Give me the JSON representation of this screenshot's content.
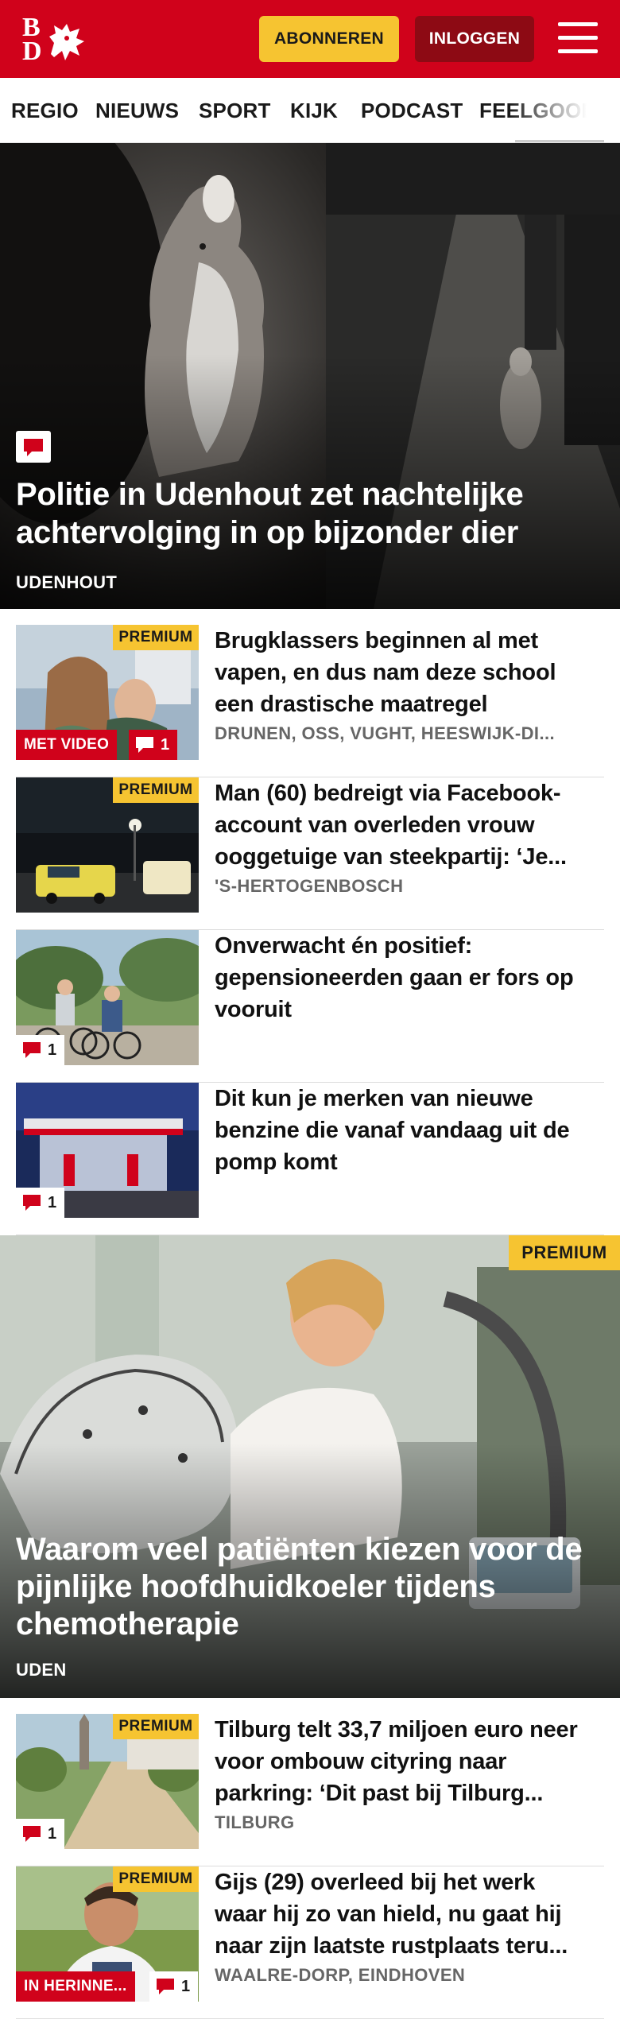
{
  "header": {
    "logo_alt": "BD",
    "logo_letters": {
      "top": "B",
      "bottom": "D"
    },
    "subscribe_label": "ABONNEREN",
    "login_label": "INLOGGEN",
    "colors": {
      "brand_red": "#d0021b",
      "subscribe_yellow": "#f6c431",
      "login_dark_red": "#8d0a14"
    }
  },
  "nav": {
    "items": [
      "REGIO",
      "NIEUWS",
      "SPORT",
      "KIJK",
      "PODCAST",
      "FEELGOOD",
      "I"
    ]
  },
  "hero1": {
    "title": "Politie in Udenhout zet nachtelijke achtervolging in op bijzonder dier",
    "location": "UDENHOUT",
    "icon": "comment-icon"
  },
  "articles": [
    {
      "title": "Brugklassers beginnen al met vapen, en dus nam deze school een drastische maatregel",
      "location": "DRUNEN, OSS, VUGHT, HEESWIJK-DI...",
      "premium": "PREMIUM",
      "video_label": "MET VIDEO",
      "comments": "1"
    },
    {
      "title": "Man (60) bedreigt via Facebook-account van overleden vrouw ooggetuige van steekpartij: ‘Je...",
      "location": "'S-HERTOGENBOSCH",
      "premium": "PREMIUM"
    },
    {
      "title": "Onverwacht én positief: gepensioneerden gaan er fors op vooruit",
      "comments": "1"
    },
    {
      "title": "Dit kun je merken van nieuwe benzine die vanaf vandaag uit de pomp komt",
      "comments": "1"
    }
  ],
  "hero2": {
    "title": "Waarom veel patiënten kiezen voor de pijnlijke hoofdhuidkoeler tijdens chemotherapie",
    "location": "UDEN",
    "premium": "PREMIUM"
  },
  "articles2": [
    {
      "title": "Tilburg telt 33,7 miljoen euro neer voor ombouw cityring naar parkring: ‘Dit past bij Tilburg...",
      "location": "TILBURG",
      "premium": "PREMIUM",
      "comments": "1"
    },
    {
      "title": "Gijs (29) overleed bij het werk waar hij zo van hield, nu gaat hij naar zijn laatste rustplaats teru...",
      "location": "WAALRE-DORP, EINDHOVEN",
      "premium": "PREMIUM",
      "memorial_label": "IN HERINNE...",
      "comments": "1"
    }
  ]
}
